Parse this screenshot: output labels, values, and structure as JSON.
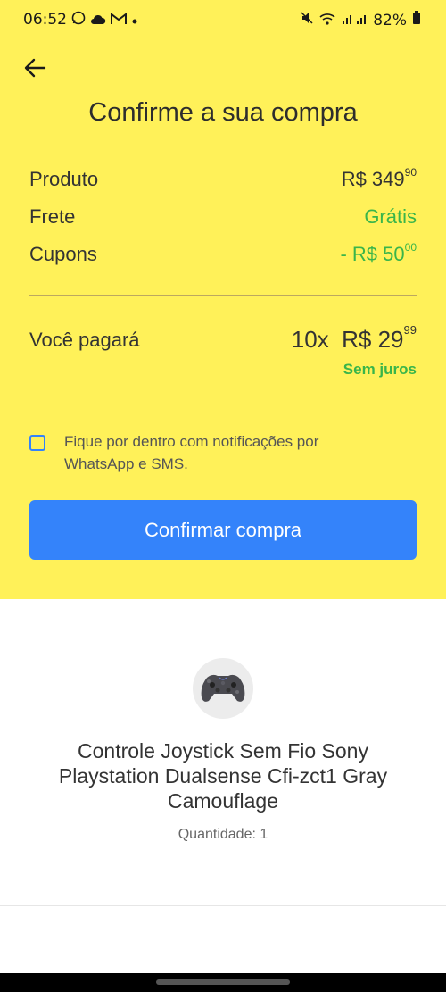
{
  "status_bar": {
    "time": "06:52",
    "battery": "82%"
  },
  "header": {
    "title": "Confirme a sua compra",
    "rows": [
      {
        "label": "Produto",
        "value_main": "R$ 349",
        "value_cents": "90"
      },
      {
        "label": "Frete",
        "value_main": "Grátis",
        "value_cents": ""
      },
      {
        "label": "Cupons",
        "value_main": "- R$ 50",
        "value_cents": "00"
      }
    ],
    "pay_label": "Você pagará",
    "installments": "10x",
    "installment_value": "R$ 29",
    "installment_cents": "99",
    "interest": "Sem juros",
    "notify_text": "Fique por dentro com notificações por WhatsApp e SMS.",
    "confirm_label": "Confirmar compra",
    "accent_color": "#3483fa",
    "green_color": "#39b54a",
    "bg_color": "#fff159"
  },
  "product": {
    "name": "Controle Joystick Sem Fio Sony Playstation Dualsense Cfi-zct1 Gray Camouflage",
    "quantity": "Quantidade: 1"
  }
}
